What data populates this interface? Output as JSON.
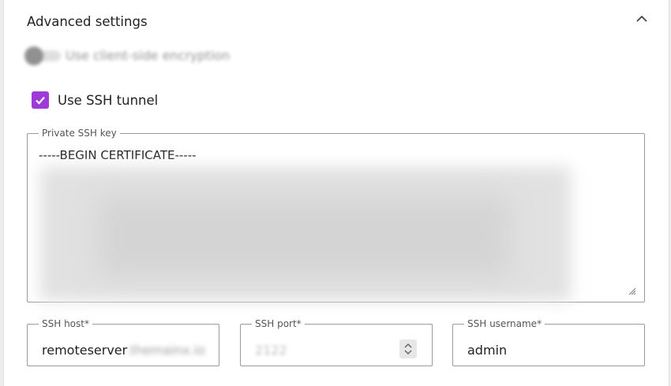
{
  "section": {
    "title": "Advanced settings"
  },
  "encryption_toggle": {
    "label": "Use client-side encryption"
  },
  "ssh_tunnel_checkbox": {
    "label": "Use SSH tunnel",
    "checked": true,
    "accent_color": "#9d3ad8"
  },
  "private_key": {
    "legend": "Private SSH key",
    "first_line": "-----BEGIN CERTIFICATE-----"
  },
  "ssh_host": {
    "legend": "SSH host*",
    "value_visible": "remoteserver",
    "value_blurred": ".themainx.io"
  },
  "ssh_port": {
    "legend": "SSH port*",
    "value": "2122"
  },
  "ssh_username": {
    "legend": "SSH username*",
    "value": "admin"
  },
  "icons": {
    "collapse": "chevron-up-icon",
    "check": "check-icon",
    "resize": "resize-grip-icon",
    "spinner": "stepper-icon"
  }
}
